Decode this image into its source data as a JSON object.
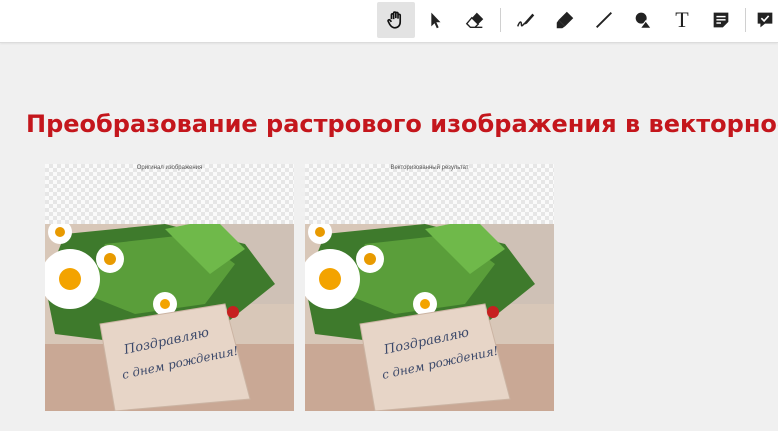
{
  "toolbar": {
    "tools": [
      {
        "name": "hand-tool",
        "icon": "hand-icon",
        "active": true
      },
      {
        "name": "select-tool",
        "icon": "cursor-arrow-icon",
        "active": false
      },
      {
        "name": "eraser-tool",
        "icon": "eraser-icon",
        "active": false
      },
      {
        "name": "pen-tool",
        "icon": "pen-icon",
        "active": false
      },
      {
        "name": "highlighter-tool",
        "icon": "highlighter-icon",
        "active": false
      },
      {
        "name": "line-tool",
        "icon": "line-icon",
        "active": false
      },
      {
        "name": "shapes-tool",
        "icon": "shapes-icon",
        "active": false
      },
      {
        "name": "text-tool",
        "icon": "text-icon",
        "active": false
      },
      {
        "name": "sticky-note-tool",
        "icon": "note-icon",
        "active": false
      },
      {
        "name": "comment-tool",
        "icon": "comment-icon",
        "active": false
      }
    ],
    "text_tool_glyph": "T"
  },
  "slide": {
    "title": "Преобразование растрового изображения в векторное",
    "title_color": "#c4161c",
    "left_caption": "Оригинал изображения",
    "right_caption": "Векторизованный результат",
    "card_line1": "Поздравляю",
    "card_line2": "с днем рождения!"
  }
}
